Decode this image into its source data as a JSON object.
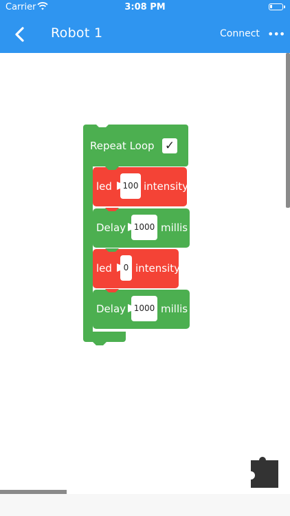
{
  "status_bar": {
    "carrier": "Carrier",
    "time": "3:08 PM"
  },
  "nav": {
    "title": "Robot 1",
    "connect_label": "Connect",
    "more_label": "•••"
  },
  "loop": {
    "label": "Repeat Loop",
    "checked": true,
    "check_glyph": "✓"
  },
  "statements": [
    {
      "type": "led",
      "label": "led",
      "value": "100",
      "suffix": "intensity",
      "color": "#f44336"
    },
    {
      "type": "delay",
      "label": "Delay",
      "value": "1000",
      "suffix": "millis",
      "color": "#4caf50"
    },
    {
      "type": "led",
      "label": "led",
      "value": "0",
      "suffix": "intensity",
      "color": "#f44336"
    },
    {
      "type": "delay",
      "label": "Delay",
      "value": "1000",
      "suffix": "millis",
      "color": "#4caf50"
    }
  ],
  "colors": {
    "nav_blue": "#2f95f0",
    "block_green": "#4caf50",
    "block_red": "#f44336"
  },
  "icons": {
    "back": "chevron-left-icon",
    "wifi": "wifi-icon",
    "battery": "battery-icon",
    "toolbox": "puzzle-piece-icon"
  }
}
